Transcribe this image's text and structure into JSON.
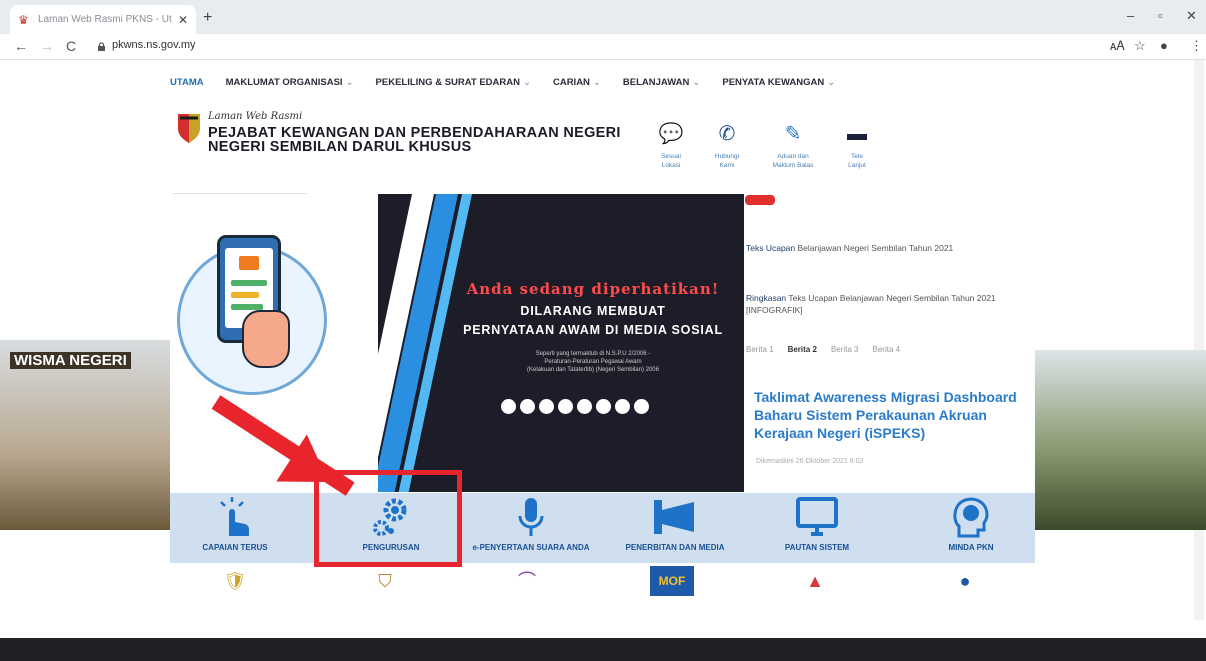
{
  "browser": {
    "tab_title": "Laman Web Rasmi PKNS - Ut",
    "close_glyph": "✕",
    "new_tab_glyph": "+",
    "url": "pkwns.ns.gov.my",
    "back_glyph": "←",
    "forward_glyph": "→",
    "reload_glyph": "C",
    "translate_glyph": "🗚",
    "star_glyph": "☆",
    "account_glyph": "●",
    "menu_glyph": "⋮",
    "minimize_glyph": "–",
    "restore_glyph": "▫",
    "window_close_glyph": "✕"
  },
  "menu": [
    {
      "label": "UTAMA",
      "active": true,
      "caret": ""
    },
    {
      "label": "MAKLUMAT ORGANISASI",
      "active": false,
      "caret": "⌄"
    },
    {
      "label": "PEKELILING & SURAT EDARAN",
      "active": false,
      "caret": "⌄"
    },
    {
      "label": "CARIAN",
      "active": false,
      "caret": "⌄"
    },
    {
      "label": "BELANJAWAN",
      "active": false,
      "caret": "⌄"
    },
    {
      "label": "PENYATA KEWANGAN",
      "active": false,
      "caret": "⌄"
    }
  ],
  "header": {
    "subtitle": "Laman Web Rasmi",
    "title_line1": "PEJABAT KEWANGAN DAN PERBENDAHARAAN NEGERI",
    "title_line2": "NEGERI SEMBILAN DARUL KHUSUS"
  },
  "quick_links": [
    {
      "icon": "chat-icon",
      "label1": "Sesuai",
      "label2": "Lokasi",
      "color": "#d83a3a"
    },
    {
      "icon": "phone-icon",
      "label1": "Hubungi",
      "label2": "Kami",
      "color": "#1f4f8a"
    },
    {
      "icon": "feedback-icon",
      "label1": "Aduan dan",
      "label2": "Maklum Balas",
      "color": "#2a7bc8"
    },
    {
      "icon": "chatbot-icon",
      "label1": "Tele",
      "label2": "Lanjut",
      "color": "#1a1f3a"
    }
  ],
  "hero": {
    "wisma_label": "WISMA NEGERI",
    "banner_heading": "Anda sedang diperhatikan!",
    "banner_line1": "DILARANG MEMBUAT",
    "banner_line2": "PERNYATAAN AWAM DI MEDIA SOSIAL",
    "banner_small1": "Seperti yang termaktub di N.S.P.U 2/2006 -",
    "banner_small2": "Peraturan-Peraturan Pegawai Awam",
    "banner_small3": "(Kelakuan dan Tatatertib) (Negeri Sembilan) 2006"
  },
  "news": {
    "items": [
      {
        "bold": "Teks Ucapan",
        "rest": " Belanjawan Negeri Sembilan Tahun 2021"
      },
      {
        "bold": "Ringkasan",
        "rest": " Teks Ucapan Belanjawan Negeri Sembilan Tahun 2021 [INFOGRAFIK]"
      }
    ],
    "tabs": [
      "Berita 1",
      "Berita 2",
      "Berita 3",
      "Berita 4"
    ],
    "active_tab": 1,
    "headline": "Taklimat Awareness Migrasi Dashboard Baharu Sistem Perakaunan Akruan Kerajaan Negeri (iSPEKS)",
    "headline_date": "Dikemaskini 26 Oktober 2021 8:02"
  },
  "features": [
    {
      "label": "CAPAIAN TERUS",
      "icon": "tap-hand-icon"
    },
    {
      "label": "PENGURUSAN",
      "icon": "gears-icon"
    },
    {
      "label": "e-PENYERTAAN SUARA ANDA",
      "icon": "microphone-icon"
    },
    {
      "label": "PENERBITAN DAN MEDIA",
      "icon": "megaphone-icon"
    },
    {
      "label": "PAUTAN SISTEM",
      "icon": "monitor-icon"
    },
    {
      "label": "MINDA PKN",
      "icon": "brain-head-icon"
    }
  ],
  "partner_logos": [
    {
      "name": "malaysia-crest-icon",
      "glyph": "🛡"
    },
    {
      "name": "ns-crest-icon",
      "glyph": "⛉"
    },
    {
      "name": "ansi-logo-icon",
      "glyph": "⌒"
    },
    {
      "name": "mof-logo-icon",
      "text": "MOF"
    },
    {
      "name": "jkt-logo-icon",
      "glyph": "▲"
    },
    {
      "name": "globe-logo-icon",
      "glyph": "●"
    }
  ],
  "colors": {
    "accent_blue": "#1f6fb5",
    "highlight_red": "#e8252c",
    "banner_dark": "#1c1d29",
    "icon_bar": "#cfdff0"
  }
}
